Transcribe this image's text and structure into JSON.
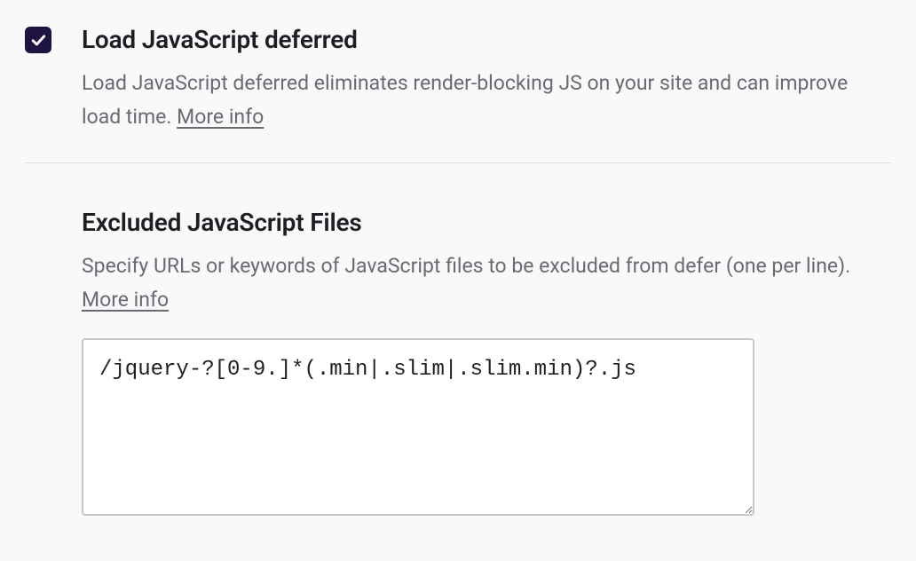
{
  "defer": {
    "title": "Load JavaScript deferred",
    "description_prefix": "Load JavaScript deferred eliminates render-blocking JS on your site and can improve load time. ",
    "more_info": "More info",
    "checked": true
  },
  "exclude": {
    "title": "Excluded JavaScript Files",
    "description_prefix": "Specify URLs or keywords of JavaScript files to be excluded from defer (one per line). ",
    "more_info": "More info",
    "value": "/jquery-?[0-9.]*(.min|.slim|.slim.min)?.js"
  }
}
